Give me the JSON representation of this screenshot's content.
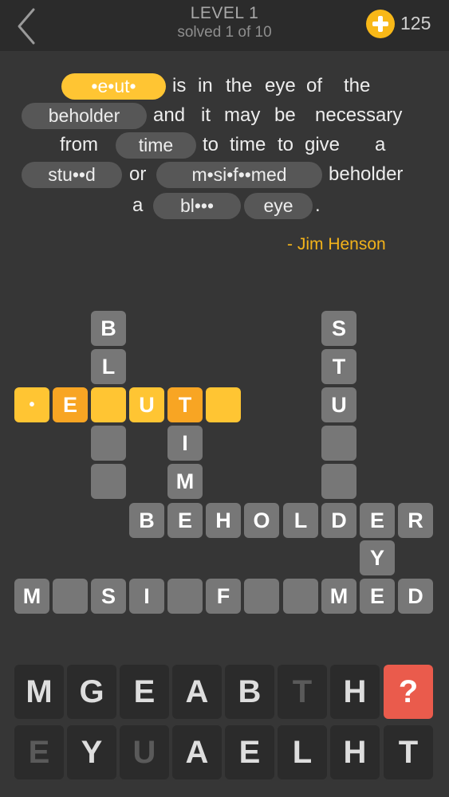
{
  "header": {
    "level": "LEVEL 1",
    "progress": "solved 1 of 10",
    "coins": "125"
  },
  "quote": {
    "words": {
      "w1": "is",
      "w2": "in",
      "w3": "the",
      "w4": "eye",
      "w5": "of",
      "w6": "the",
      "w7": "and",
      "w8": "it",
      "w9": "may",
      "w10": "be",
      "w11": "necessary",
      "w12": "from",
      "w13": "to",
      "w14": "time",
      "w15": "to",
      "w16": "give",
      "w17": "a",
      "w18": "or",
      "w19": "beholder",
      "w20": "a",
      "w21": "."
    },
    "blanks": {
      "beauty": "•e•ut•",
      "beholder": "beholder",
      "time": "time",
      "stupid": "stu••d",
      "misinformed": "m•si•f••med",
      "black": "bl•••",
      "eye": "eye"
    },
    "author": "- Jim Henson"
  },
  "grid": {
    "black": [
      "B",
      "L",
      "",
      "",
      ""
    ],
    "beauty": [
      "•",
      "E",
      "",
      "U",
      "T",
      ""
    ],
    "stim": [
      "I",
      "M"
    ],
    "stupid": [
      "S",
      "T",
      "U",
      "",
      ""
    ],
    "beholder": [
      "B",
      "E",
      "H",
      "O",
      "L",
      "D",
      "E",
      "R"
    ],
    "eye": [
      "Y"
    ],
    "misinformed": [
      "M",
      "",
      "S",
      "I",
      "",
      "F",
      "",
      "",
      "M",
      "E",
      "D"
    ]
  },
  "keyboard": {
    "row1": [
      "M",
      "G",
      "E",
      "A",
      "B",
      "T",
      "H",
      "?"
    ],
    "row2": [
      "E",
      "Y",
      "U",
      "A",
      "E",
      "L",
      "H",
      "T"
    ]
  },
  "colors": {
    "background": "#363636",
    "header": "#2b2b2b",
    "accent_yellow": "#ffc533",
    "accent_orange": "#f8a523",
    "coin": "#f8b818",
    "author": "#f3b31a",
    "tile": "#777777",
    "hint_key": "#ea5b4c"
  },
  "icons": {
    "back": "chevron-left-icon",
    "coin_add": "plus-circle-icon",
    "hint": "question-mark-icon"
  }
}
